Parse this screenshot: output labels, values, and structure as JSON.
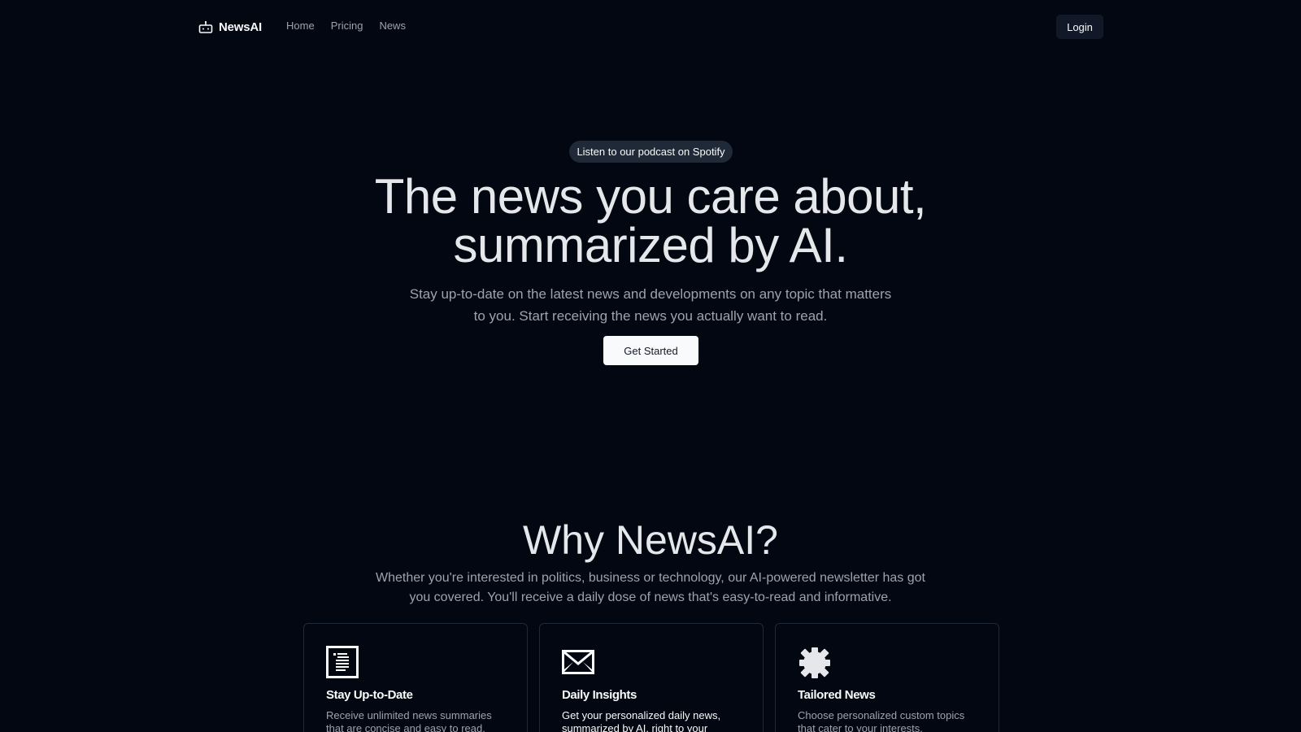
{
  "nav": {
    "brand": "NewsAI",
    "brand_icon": "robot-icon",
    "links": [
      "Home",
      "Pricing",
      "News"
    ],
    "login_label": "Login"
  },
  "hero": {
    "pill": "Listen to our podcast on Spotify",
    "title_line1": "The news you care about,",
    "title_line2": "summarized by AI.",
    "subtitle": "Stay up-to-date on the latest news and developments on any topic that matters to you. Start receiving the news you actually want to read.",
    "cta_label": "Get Started"
  },
  "why": {
    "title": "Why NewsAI?",
    "subtitle": "Whether you're interested in politics, business or technology, our AI-powered newsletter has got you covered. You'll receive a daily dose of news that's easy-to-read and informative.",
    "cards": [
      {
        "icon": "newspaper-icon",
        "title": "Stay Up-to-Date",
        "text": "Receive unlimited news summaries that are concise and easy to read."
      },
      {
        "icon": "envelope-icon",
        "title": "Daily Insights",
        "text": "Get your personalized daily news, summarized by AI, right to your inbox."
      },
      {
        "icon": "gear-icon",
        "title": "Tailored News",
        "text": "Choose personalized custom topics that cater to your interests."
      }
    ]
  },
  "colors": {
    "background": "#030712",
    "text_primary": "#e5e7eb",
    "text_muted": "#9ca3af",
    "button_dark": "#111827",
    "button_light": "#f9fafb"
  }
}
